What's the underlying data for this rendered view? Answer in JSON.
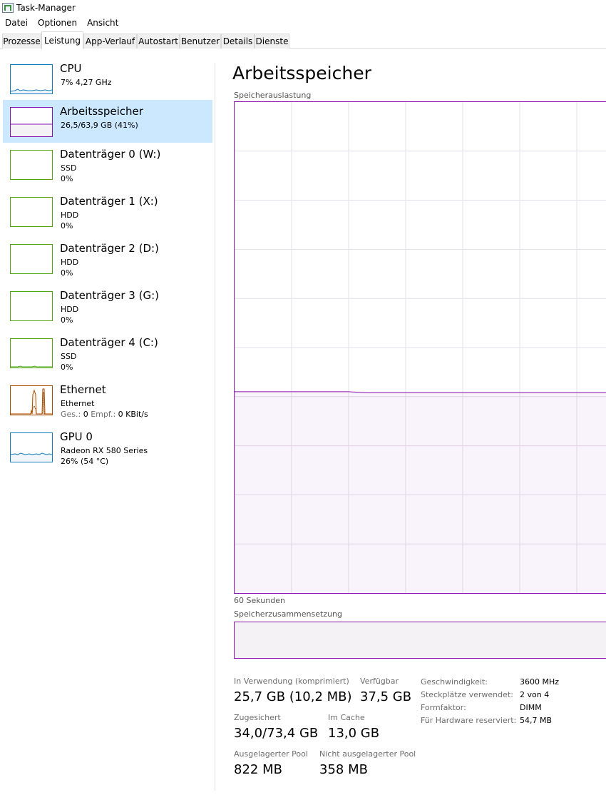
{
  "window": {
    "title": "Task-Manager"
  },
  "menu": [
    "Datei",
    "Optionen",
    "Ansicht"
  ],
  "tabs": [
    {
      "label": "Prozesse",
      "active": false
    },
    {
      "label": "Leistung",
      "active": true
    },
    {
      "label": "App-Verlauf",
      "active": false
    },
    {
      "label": "Autostart",
      "active": false
    },
    {
      "label": "Benutzer",
      "active": false
    },
    {
      "label": "Details",
      "active": false
    },
    {
      "label": "Dienste",
      "active": false
    }
  ],
  "resources": [
    {
      "name": "CPU",
      "sub1": "7% 4,27 GHz",
      "sub2": "",
      "color": "#117dbb",
      "selected": false
    },
    {
      "name": "Arbeitsspeicher",
      "sub1": "26,5/63,9 GB (41%)",
      "sub2": "",
      "color": "#8b12ae",
      "selected": true
    },
    {
      "name": "Datenträger 0 (W:)",
      "sub1": "SSD",
      "sub2": "0%",
      "color": "#4da60c",
      "selected": false
    },
    {
      "name": "Datenträger 1 (X:)",
      "sub1": "HDD",
      "sub2": "0%",
      "color": "#4da60c",
      "selected": false
    },
    {
      "name": "Datenträger 2 (D:)",
      "sub1": "HDD",
      "sub2": "0%",
      "color": "#4da60c",
      "selected": false
    },
    {
      "name": "Datenträger 3 (G:)",
      "sub1": "HDD",
      "sub2": "0%",
      "color": "#4da60c",
      "selected": false
    },
    {
      "name": "Datenträger 4 (C:)",
      "sub1": "SSD",
      "sub2": "0%",
      "color": "#4da60c",
      "selected": false
    },
    {
      "name": "Ethernet",
      "sub1": "Ethernet",
      "sub2_label_send": "Ges.:",
      "sub2_val_send": "0",
      "sub2_label_recv": "Empf.:",
      "sub2_val_recv": "0 KBit/s",
      "color": "#a74f01",
      "selected": false
    },
    {
      "name": "GPU 0",
      "sub1": "Radeon RX 580 Series",
      "sub2": "26% (54 °C)",
      "color": "#117dbb",
      "selected": false
    }
  ],
  "main": {
    "title": "Arbeitsspeicher",
    "graph_label": "Speicherauslastung",
    "time_label": "60 Sekunden",
    "composition_label": "Speicherzusammensetzung",
    "usage_percent": 41,
    "accent": "#8b12ae"
  },
  "stats": {
    "in_use_label": "In Verwendung (komprimiert)",
    "in_use_value": "25,7 GB (10,2 MB)",
    "available_label": "Verfügbar",
    "available_value": "37,5 GB",
    "committed_label": "Zugesichert",
    "committed_value": "34,0/73,4 GB",
    "cached_label": "Im Cache",
    "cached_value": "13,0 GB",
    "paged_label": "Ausgelagerter Pool",
    "paged_value": "822 MB",
    "nonpaged_label": "Nicht ausgelagerter Pool",
    "nonpaged_value": "358 MB"
  },
  "specs": [
    {
      "label": "Geschwindigkeit:",
      "value": "3600 MHz"
    },
    {
      "label": "Steckplätze verwendet:",
      "value": "2 von 4"
    },
    {
      "label": "Formfaktor:",
      "value": "DIMM"
    },
    {
      "label": "Für Hardware reserviert:",
      "value": "54,7 MB"
    }
  ]
}
